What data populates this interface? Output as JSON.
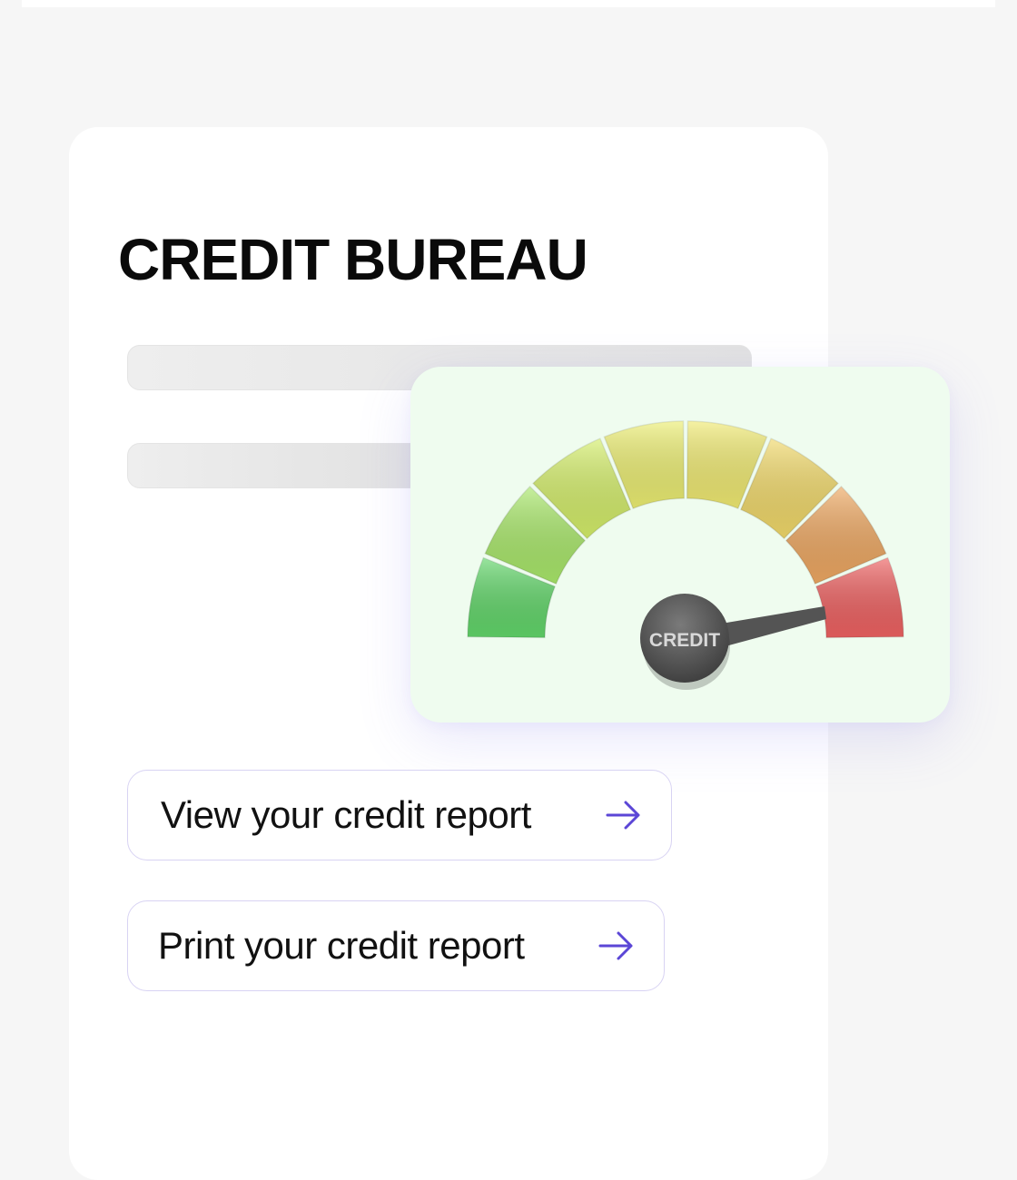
{
  "title": "CREDIT BUREAU",
  "gauge": {
    "label": "CREDIT",
    "segment_colors": [
      "#62d66a",
      "#a9e86a",
      "#d4ee6a",
      "#ecee72",
      "#f0ea72",
      "#f1d96a",
      "#eea862",
      "#ee6262"
    ],
    "needle_color": "#545454"
  },
  "actions": [
    {
      "label": "View your credit report",
      "icon": "arrow-right-icon"
    },
    {
      "label": "Print your credit report",
      "icon": "arrow-right-icon"
    }
  ],
  "accent_color": "#5b46d6"
}
